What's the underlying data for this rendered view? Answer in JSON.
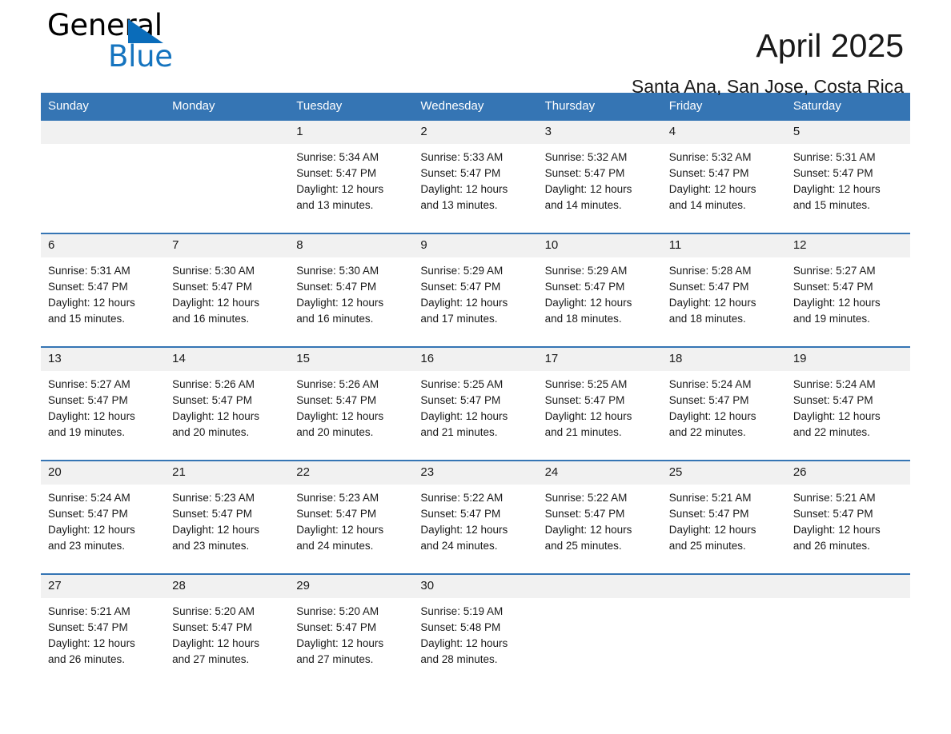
{
  "brand": {
    "name_part1": "General",
    "name_part2": "Blue",
    "triangle_color": "#0a6cba",
    "blue_color": "#1574bf"
  },
  "header": {
    "title": "April 2025",
    "subtitle": "Santa Ana, San Jose, Costa Rica"
  },
  "theme": {
    "header_blue": "#3575b4",
    "daynum_bg": "#f1f1f1",
    "text": "#1a1a1a"
  },
  "calendar": {
    "weekday_headers": [
      "Sunday",
      "Monday",
      "Tuesday",
      "Wednesday",
      "Thursday",
      "Friday",
      "Saturday"
    ],
    "weeks": [
      [
        {
          "day": "",
          "sunrise": "",
          "sunset": "",
          "daylight_line1": "",
          "daylight_line2": ""
        },
        {
          "day": "",
          "sunrise": "",
          "sunset": "",
          "daylight_line1": "",
          "daylight_line2": ""
        },
        {
          "day": "1",
          "sunrise": "Sunrise: 5:34 AM",
          "sunset": "Sunset: 5:47 PM",
          "daylight_line1": "Daylight: 12 hours",
          "daylight_line2": "and 13 minutes."
        },
        {
          "day": "2",
          "sunrise": "Sunrise: 5:33 AM",
          "sunset": "Sunset: 5:47 PM",
          "daylight_line1": "Daylight: 12 hours",
          "daylight_line2": "and 13 minutes."
        },
        {
          "day": "3",
          "sunrise": "Sunrise: 5:32 AM",
          "sunset": "Sunset: 5:47 PM",
          "daylight_line1": "Daylight: 12 hours",
          "daylight_line2": "and 14 minutes."
        },
        {
          "day": "4",
          "sunrise": "Sunrise: 5:32 AM",
          "sunset": "Sunset: 5:47 PM",
          "daylight_line1": "Daylight: 12 hours",
          "daylight_line2": "and 14 minutes."
        },
        {
          "day": "5",
          "sunrise": "Sunrise: 5:31 AM",
          "sunset": "Sunset: 5:47 PM",
          "daylight_line1": "Daylight: 12 hours",
          "daylight_line2": "and 15 minutes."
        }
      ],
      [
        {
          "day": "6",
          "sunrise": "Sunrise: 5:31 AM",
          "sunset": "Sunset: 5:47 PM",
          "daylight_line1": "Daylight: 12 hours",
          "daylight_line2": "and 15 minutes."
        },
        {
          "day": "7",
          "sunrise": "Sunrise: 5:30 AM",
          "sunset": "Sunset: 5:47 PM",
          "daylight_line1": "Daylight: 12 hours",
          "daylight_line2": "and 16 minutes."
        },
        {
          "day": "8",
          "sunrise": "Sunrise: 5:30 AM",
          "sunset": "Sunset: 5:47 PM",
          "daylight_line1": "Daylight: 12 hours",
          "daylight_line2": "and 16 minutes."
        },
        {
          "day": "9",
          "sunrise": "Sunrise: 5:29 AM",
          "sunset": "Sunset: 5:47 PM",
          "daylight_line1": "Daylight: 12 hours",
          "daylight_line2": "and 17 minutes."
        },
        {
          "day": "10",
          "sunrise": "Sunrise: 5:29 AM",
          "sunset": "Sunset: 5:47 PM",
          "daylight_line1": "Daylight: 12 hours",
          "daylight_line2": "and 18 minutes."
        },
        {
          "day": "11",
          "sunrise": "Sunrise: 5:28 AM",
          "sunset": "Sunset: 5:47 PM",
          "daylight_line1": "Daylight: 12 hours",
          "daylight_line2": "and 18 minutes."
        },
        {
          "day": "12",
          "sunrise": "Sunrise: 5:27 AM",
          "sunset": "Sunset: 5:47 PM",
          "daylight_line1": "Daylight: 12 hours",
          "daylight_line2": "and 19 minutes."
        }
      ],
      [
        {
          "day": "13",
          "sunrise": "Sunrise: 5:27 AM",
          "sunset": "Sunset: 5:47 PM",
          "daylight_line1": "Daylight: 12 hours",
          "daylight_line2": "and 19 minutes."
        },
        {
          "day": "14",
          "sunrise": "Sunrise: 5:26 AM",
          "sunset": "Sunset: 5:47 PM",
          "daylight_line1": "Daylight: 12 hours",
          "daylight_line2": "and 20 minutes."
        },
        {
          "day": "15",
          "sunrise": "Sunrise: 5:26 AM",
          "sunset": "Sunset: 5:47 PM",
          "daylight_line1": "Daylight: 12 hours",
          "daylight_line2": "and 20 minutes."
        },
        {
          "day": "16",
          "sunrise": "Sunrise: 5:25 AM",
          "sunset": "Sunset: 5:47 PM",
          "daylight_line1": "Daylight: 12 hours",
          "daylight_line2": "and 21 minutes."
        },
        {
          "day": "17",
          "sunrise": "Sunrise: 5:25 AM",
          "sunset": "Sunset: 5:47 PM",
          "daylight_line1": "Daylight: 12 hours",
          "daylight_line2": "and 21 minutes."
        },
        {
          "day": "18",
          "sunrise": "Sunrise: 5:24 AM",
          "sunset": "Sunset: 5:47 PM",
          "daylight_line1": "Daylight: 12 hours",
          "daylight_line2": "and 22 minutes."
        },
        {
          "day": "19",
          "sunrise": "Sunrise: 5:24 AM",
          "sunset": "Sunset: 5:47 PM",
          "daylight_line1": "Daylight: 12 hours",
          "daylight_line2": "and 22 minutes."
        }
      ],
      [
        {
          "day": "20",
          "sunrise": "Sunrise: 5:24 AM",
          "sunset": "Sunset: 5:47 PM",
          "daylight_line1": "Daylight: 12 hours",
          "daylight_line2": "and 23 minutes."
        },
        {
          "day": "21",
          "sunrise": "Sunrise: 5:23 AM",
          "sunset": "Sunset: 5:47 PM",
          "daylight_line1": "Daylight: 12 hours",
          "daylight_line2": "and 23 minutes."
        },
        {
          "day": "22",
          "sunrise": "Sunrise: 5:23 AM",
          "sunset": "Sunset: 5:47 PM",
          "daylight_line1": "Daylight: 12 hours",
          "daylight_line2": "and 24 minutes."
        },
        {
          "day": "23",
          "sunrise": "Sunrise: 5:22 AM",
          "sunset": "Sunset: 5:47 PM",
          "daylight_line1": "Daylight: 12 hours",
          "daylight_line2": "and 24 minutes."
        },
        {
          "day": "24",
          "sunrise": "Sunrise: 5:22 AM",
          "sunset": "Sunset: 5:47 PM",
          "daylight_line1": "Daylight: 12 hours",
          "daylight_line2": "and 25 minutes."
        },
        {
          "day": "25",
          "sunrise": "Sunrise: 5:21 AM",
          "sunset": "Sunset: 5:47 PM",
          "daylight_line1": "Daylight: 12 hours",
          "daylight_line2": "and 25 minutes."
        },
        {
          "day": "26",
          "sunrise": "Sunrise: 5:21 AM",
          "sunset": "Sunset: 5:47 PM",
          "daylight_line1": "Daylight: 12 hours",
          "daylight_line2": "and 26 minutes."
        }
      ],
      [
        {
          "day": "27",
          "sunrise": "Sunrise: 5:21 AM",
          "sunset": "Sunset: 5:47 PM",
          "daylight_line1": "Daylight: 12 hours",
          "daylight_line2": "and 26 minutes."
        },
        {
          "day": "28",
          "sunrise": "Sunrise: 5:20 AM",
          "sunset": "Sunset: 5:47 PM",
          "daylight_line1": "Daylight: 12 hours",
          "daylight_line2": "and 27 minutes."
        },
        {
          "day": "29",
          "sunrise": "Sunrise: 5:20 AM",
          "sunset": "Sunset: 5:47 PM",
          "daylight_line1": "Daylight: 12 hours",
          "daylight_line2": "and 27 minutes."
        },
        {
          "day": "30",
          "sunrise": "Sunrise: 5:19 AM",
          "sunset": "Sunset: 5:48 PM",
          "daylight_line1": "Daylight: 12 hours",
          "daylight_line2": "and 28 minutes."
        },
        {
          "day": "",
          "sunrise": "",
          "sunset": "",
          "daylight_line1": "",
          "daylight_line2": ""
        },
        {
          "day": "",
          "sunrise": "",
          "sunset": "",
          "daylight_line1": "",
          "daylight_line2": ""
        },
        {
          "day": "",
          "sunrise": "",
          "sunset": "",
          "daylight_line1": "",
          "daylight_line2": ""
        }
      ]
    ]
  }
}
